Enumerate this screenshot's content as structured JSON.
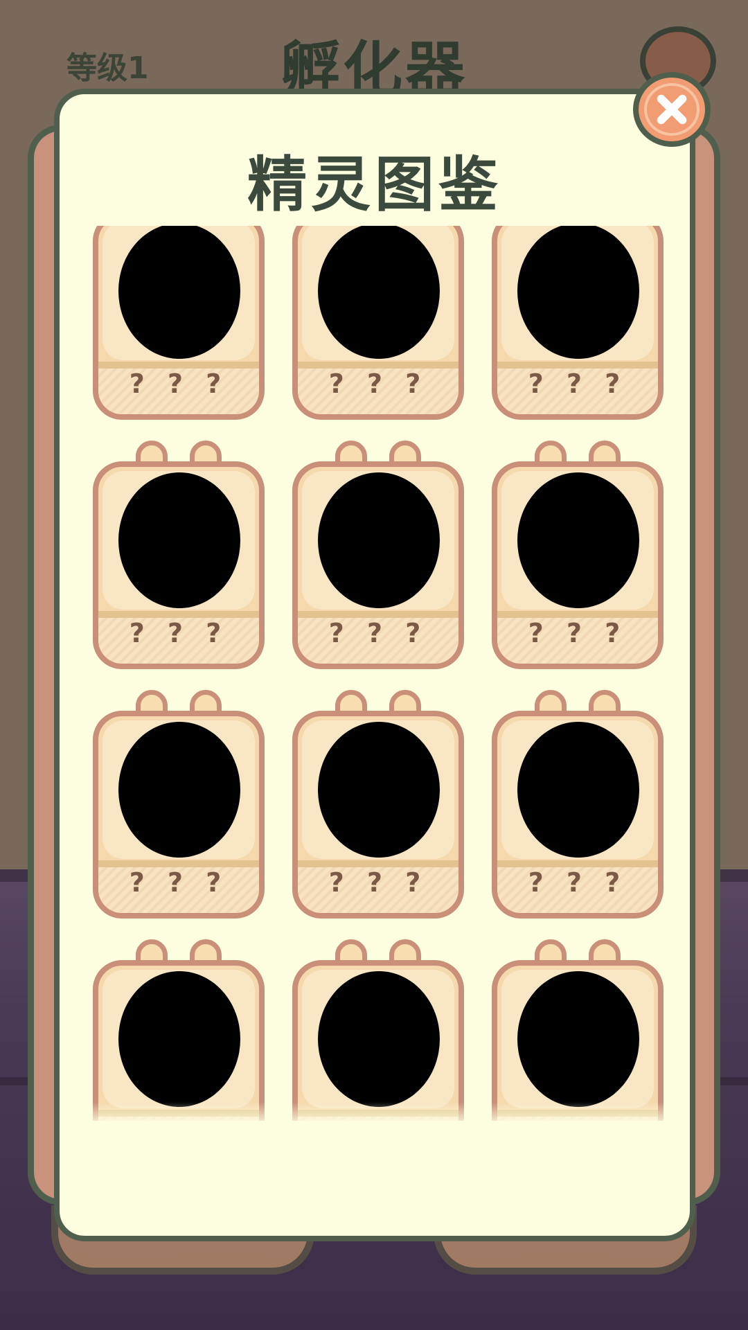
{
  "header": {
    "level_label": "等级1",
    "title": "孵化器"
  },
  "modal": {
    "title": "精灵图鉴",
    "cards": [
      {
        "name_label": "? ? ?",
        "locked": true
      },
      {
        "name_label": "? ? ?",
        "locked": true
      },
      {
        "name_label": "? ? ?",
        "locked": true
      },
      {
        "name_label": "? ? ?",
        "locked": true
      },
      {
        "name_label": "? ? ?",
        "locked": true
      },
      {
        "name_label": "? ? ?",
        "locked": true
      },
      {
        "name_label": "? ? ?",
        "locked": true
      },
      {
        "name_label": "? ? ?",
        "locked": true
      },
      {
        "name_label": "? ? ?",
        "locked": true
      },
      {
        "name_label": "? ? ?",
        "locked": true
      },
      {
        "name_label": "? ? ?",
        "locked": true
      },
      {
        "name_label": "? ? ?",
        "locked": true
      }
    ],
    "close_icon": "close-icon"
  },
  "colors": {
    "panel_bg": "#fefee0",
    "panel_border": "#4f5f4c",
    "card_border": "#c98f78",
    "close_button": "#f29c73"
  }
}
